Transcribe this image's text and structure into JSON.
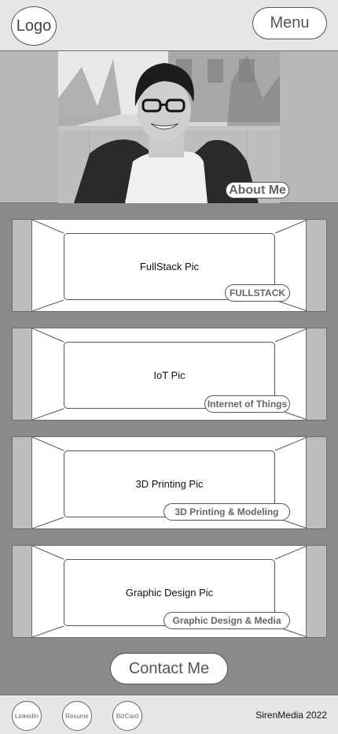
{
  "header": {
    "logo_label": "Logo",
    "menu_label": "Menu"
  },
  "hero": {
    "photo_icon": "portrait-photo",
    "about_label": "About Me"
  },
  "cards": [
    {
      "pic_label": "FullStack Pic",
      "badge_label": "FULLSTACK"
    },
    {
      "pic_label": "IoT Pic",
      "badge_label": "Internet of Things"
    },
    {
      "pic_label": "3D Printing Pic",
      "badge_label": "3D Printing & Modeling"
    },
    {
      "pic_label": "Graphic Design Pic",
      "badge_label": "Graphic Design & Media"
    }
  ],
  "contact": {
    "label": "Contact Me"
  },
  "footer": {
    "links": [
      "LinkedIn",
      "Resume",
      "BizCard"
    ],
    "copyright": "SirenMedia 2022"
  }
}
